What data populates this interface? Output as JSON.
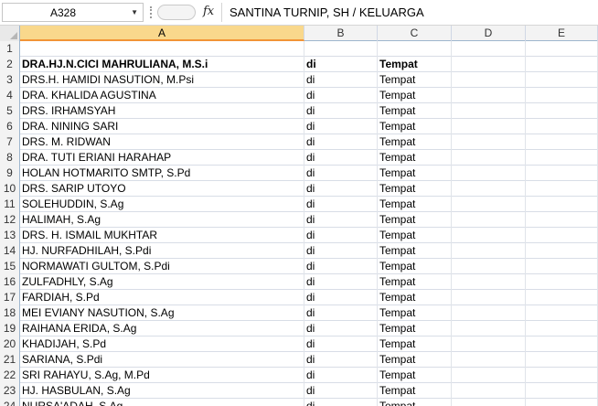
{
  "formula_bar": {
    "cell_ref": "A328",
    "formula": "SANTINA TURNIP, SH / KELUARGA"
  },
  "columns": [
    "A",
    "B",
    "C",
    "D",
    "E"
  ],
  "rows": [
    {
      "num": "1",
      "a": "",
      "b": "",
      "c": ""
    },
    {
      "num": "2",
      "a": "DRA.HJ.N.CICI MAHRULIANA, M.S.i",
      "b": "di",
      "c": "Tempat",
      "bold": true
    },
    {
      "num": "3",
      "a": "DRS.H. HAMIDI NASUTION, M.Psi",
      "b": "di",
      "c": "Tempat"
    },
    {
      "num": "4",
      "a": "DRA. KHALIDA AGUSTINA",
      "b": "di",
      "c": "Tempat"
    },
    {
      "num": "5",
      "a": "DRS. IRHAMSYAH",
      "b": "di",
      "c": "Tempat"
    },
    {
      "num": "6",
      "a": "DRA. NINING SARI",
      "b": "di",
      "c": "Tempat"
    },
    {
      "num": "7",
      "a": "DRS. M. RIDWAN",
      "b": "di",
      "c": "Tempat"
    },
    {
      "num": "8",
      "a": "DRA. TUTI ERIANI HARAHAP",
      "b": "di",
      "c": "Tempat"
    },
    {
      "num": "9",
      "a": "HOLAN HOTMARITO SMTP, S.Pd",
      "b": "di",
      "c": "Tempat"
    },
    {
      "num": "10",
      "a": "DRS. SARIP UTOYO",
      "b": "di",
      "c": "Tempat"
    },
    {
      "num": "11",
      "a": "SOLEHUDDIN, S.Ag",
      "b": "di",
      "c": "Tempat"
    },
    {
      "num": "12",
      "a": "HALIMAH, S.Ag",
      "b": "di",
      "c": "Tempat"
    },
    {
      "num": "13",
      "a": "DRS. H. ISMAIL MUKHTAR",
      "b": "di",
      "c": "Tempat"
    },
    {
      "num": "14",
      "a": "HJ. NURFADHILAH, S.Pdi",
      "b": "di",
      "c": "Tempat"
    },
    {
      "num": "15",
      "a": "NORMAWATI GULTOM, S.Pdi",
      "b": "di",
      "c": "Tempat"
    },
    {
      "num": "16",
      "a": "ZULFADHLY, S.Ag",
      "b": "di",
      "c": "Tempat"
    },
    {
      "num": "17",
      "a": "FARDIAH, S.Pd",
      "b": "di",
      "c": "Tempat"
    },
    {
      "num": "18",
      "a": "MEI EVIANY NASUTION, S.Ag",
      "b": "di",
      "c": "Tempat"
    },
    {
      "num": "19",
      "a": "RAIHANA ERIDA, S.Ag",
      "b": "di",
      "c": "Tempat"
    },
    {
      "num": "20",
      "a": "KHADIJAH, S.Pd",
      "b": "di",
      "c": "Tempat"
    },
    {
      "num": "21",
      "a": "SARIANA, S.Pdi",
      "b": "di",
      "c": "Tempat"
    },
    {
      "num": "22",
      "a": "SRI RAHAYU, S.Ag, M.Pd",
      "b": "di",
      "c": "Tempat"
    },
    {
      "num": "23",
      "a": "HJ. HASBULAN, S.Ag",
      "b": "di",
      "c": "Tempat"
    },
    {
      "num": "24",
      "a": "NURSA'ADAH, S.Ag",
      "b": "di",
      "c": "Tempat"
    }
  ]
}
